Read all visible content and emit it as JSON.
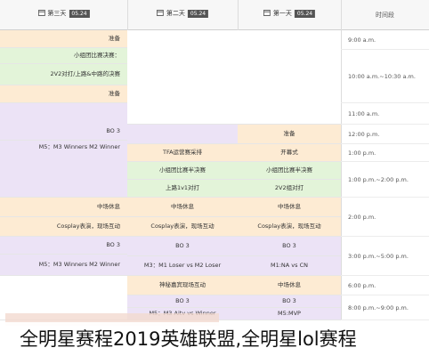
{
  "header": {
    "day3_label": "第三天",
    "day3_date": "05.24",
    "day2_label": "第二天",
    "day2_date": "05.24",
    "day1_label": "第一天",
    "day1_date": "05.24",
    "time_head": "时间段"
  },
  "times": [
    "9:00 a.m.",
    "10:00 a.m.~10:30 a.m.",
    "11:00 a.m.",
    "12:00 p.m.",
    "1:00 p.m.",
    "1:00 p.m.~2:00 p.m.",
    "2:00 p.m.",
    "3:00 p.m.~5:00 p.m.",
    "6:00 p.m.",
    "8:00 p.m.~9:00 p.m."
  ],
  "day3": {
    "ready1": "准备",
    "group_final_1": "小组团比赛决赛：",
    "group_final_2": "2V2对打/上路&中路的决赛",
    "ready2": "准备",
    "bo3_a": "BO 3",
    "m5_a": "M5：M3 Winners M2 Winner",
    "midbreak": "中场休息",
    "cosplay": "Cosplay表演，现场互动",
    "bo3_b": "BO 3",
    "m5_b": "M5：M3 Winners M2 Winner"
  },
  "day2": {
    "tfa": "TFA运营赛采排",
    "semi": "小组团比赛半决赛",
    "top_one": "上路1v1对打",
    "midbreak": "中场休息",
    "cosplay": "Cosplay表演，现场互动",
    "bo3": "BO 3",
    "m3": "M3：M1 Loser vs M2 Loser",
    "stage": "神秘嘉宾现场互动",
    "bo3_b": "BO 3",
    "m5": "M5：M3 Aitv vs Winner"
  },
  "day1": {
    "ready": "准备",
    "opening": "开幕式",
    "semi": "小组团比赛半决赛",
    "duo": "2V2组对打",
    "midbreak": "中场休息",
    "cosplay": "Cosplay表演，现场互动",
    "bo3": "BO 3",
    "m1": "M1:NA vs CN",
    "midbreak2": "中场休息",
    "bo3_b": "BO 3",
    "m1_b": "M5:MVP"
  },
  "caption": "全明星赛程2019英雄联盟,全明星lol赛程"
}
